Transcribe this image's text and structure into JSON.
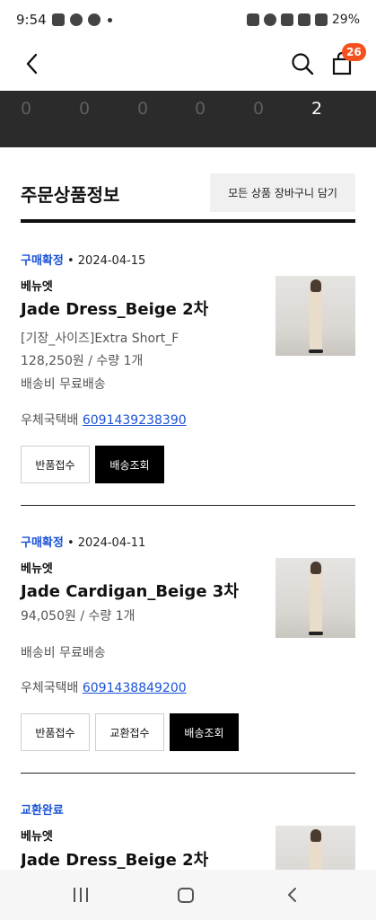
{
  "status_bar": {
    "time": "9:54",
    "battery": "29%"
  },
  "header": {
    "cart_count": "26"
  },
  "counts": [
    "0",
    "0",
    "0",
    "0",
    "0",
    "2"
  ],
  "section": {
    "title": "주문상품정보",
    "add_all_to_cart": "모든 상품 장바구니 담기"
  },
  "orders": [
    {
      "status": "구매확정",
      "date": " • 2024-04-15",
      "brand": "베뉴엣",
      "name": "Jade Dress_Beige 2차",
      "option": "[기장_사이즈]Extra Short_F",
      "price_qty": "128,250원 / 수량 1개",
      "shipping": "배송비 무료배송",
      "courier": "우체국택배 ",
      "tracking": "6091439238390",
      "buttons": [
        "반품접수",
        "배송조회"
      ]
    },
    {
      "status": "구매확정",
      "date": " • 2024-04-11",
      "brand": "베뉴엣",
      "name": "Jade Cardigan_Beige 3차",
      "price_qty": "94,050원 / 수량 1개",
      "shipping": "배송비 무료배송",
      "courier": "우체국택배 ",
      "tracking": "6091438849200",
      "buttons": [
        "반품접수",
        "교환접수",
        "배송조회"
      ]
    },
    {
      "status": "교환완료",
      "brand": "베뉴엣",
      "name": "Jade Dress_Beige 2차"
    }
  ],
  "colors": {
    "accent_blue": "#1a52d6",
    "badge_orange": "#f5511e",
    "band_dark": "#2b2b2b"
  }
}
